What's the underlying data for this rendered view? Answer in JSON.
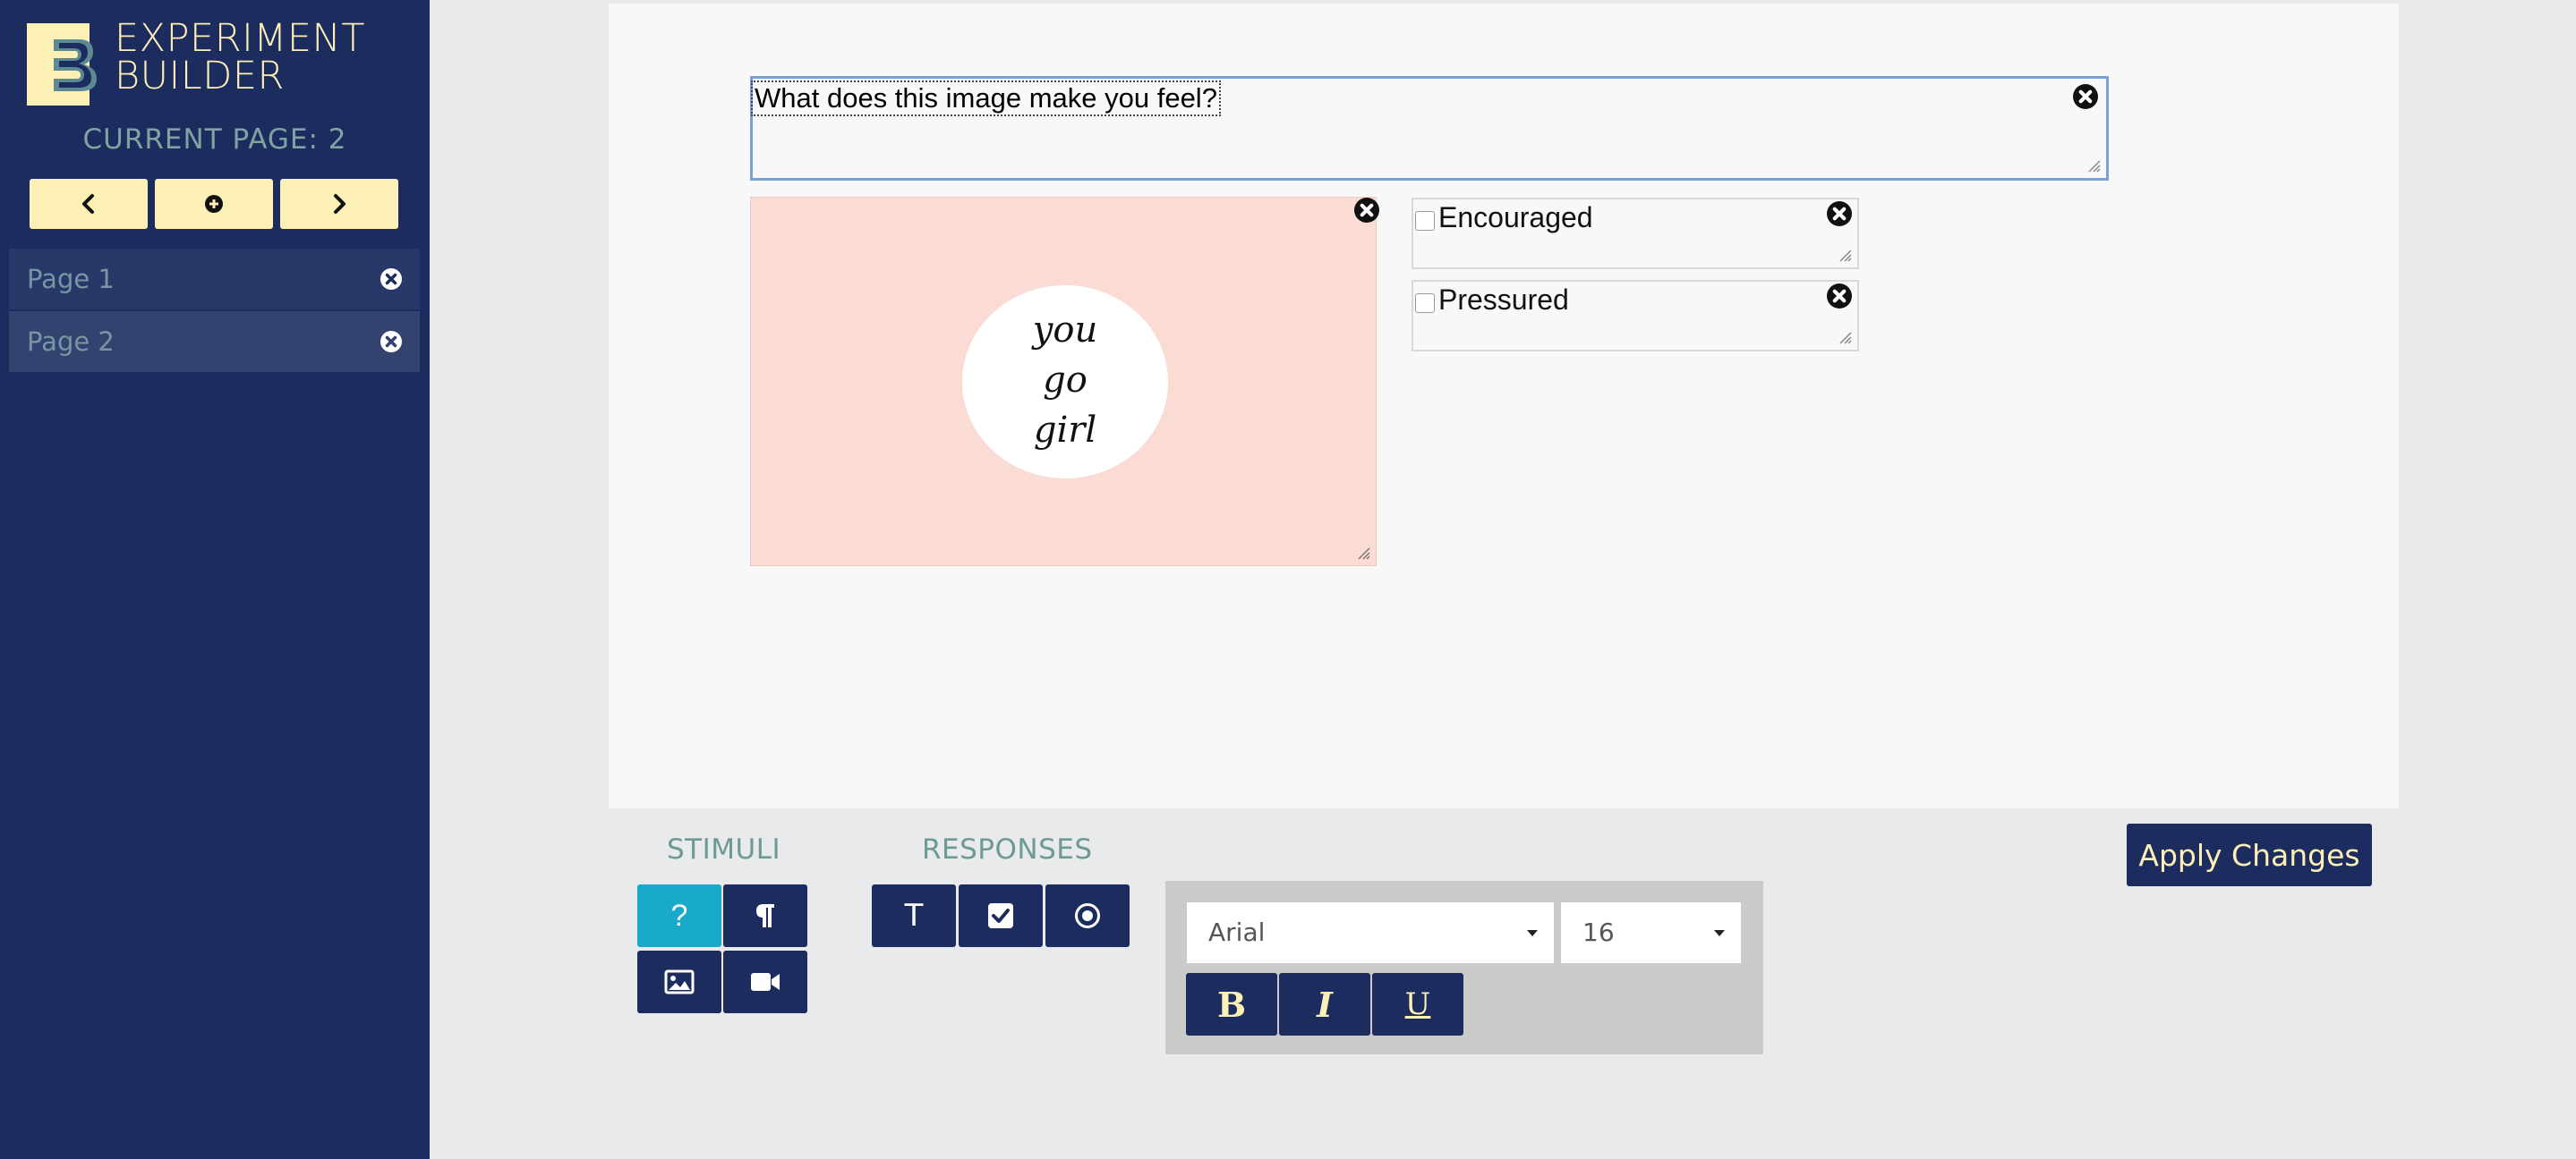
{
  "sidebar": {
    "brand_line1": "EXPERIMENT",
    "brand_line2": "BUILDER",
    "current_page_label": "CURRENT PAGE: 2",
    "nav": {
      "prev_icon": "chevron-left-icon",
      "add_icon": "plus-circle-icon",
      "next_icon": "chevron-right-icon"
    },
    "pages": [
      {
        "label": "Page 1",
        "selected": false
      },
      {
        "label": "Page 2",
        "selected": true
      }
    ]
  },
  "canvas": {
    "question_text": "What does this image make you feel?",
    "image_text_line1": "you",
    "image_text_line2": "go",
    "image_text_line3": "girl",
    "responses": [
      {
        "label": "Encouraged",
        "checked": false
      },
      {
        "label": "Pressured",
        "checked": false
      }
    ]
  },
  "toolbar": {
    "stimuli_title": "STIMULI",
    "responses_title": "RESPONSES",
    "stimuli_tools": [
      "question-icon",
      "paragraph-icon",
      "image-icon",
      "video-icon"
    ],
    "response_tools": [
      "text-response-icon",
      "checkbox-icon",
      "radio-icon"
    ],
    "text_tool_label": "T",
    "question_tool_label": "?",
    "font_family": "Arial",
    "font_size": "16",
    "bold_label": "B",
    "italic_label": "I",
    "underline_label": "U",
    "apply_label": "Apply Changes"
  },
  "colors": {
    "sidebar_bg": "#1d2c5e",
    "accent_yellow": "#fdf0b6",
    "active_tool": "#19a9c9",
    "image_bg": "#fbdcd5"
  }
}
